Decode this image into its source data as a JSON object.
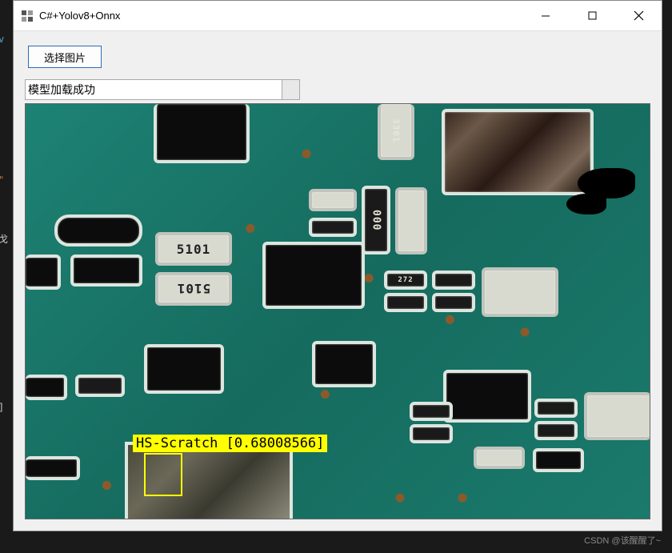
{
  "window": {
    "title": "C#+Yolov8+Onnx"
  },
  "controls": {
    "select_image_label": "选择图片"
  },
  "status": {
    "text": "模型加载成功"
  },
  "detection": {
    "label": "HS-Scratch [0.68008566]"
  },
  "pcb_markings": {
    "r_5101_a": "5101",
    "r_5101_b": "5101",
    "r_3301": "3301",
    "r_000": "000",
    "r_272": "272"
  },
  "sidebar_fragments": {
    "v": "v",
    "quote": "\"",
    "bracket": "]",
    "char": "戈"
  },
  "watermark": "CSDN @该醒醒了~"
}
